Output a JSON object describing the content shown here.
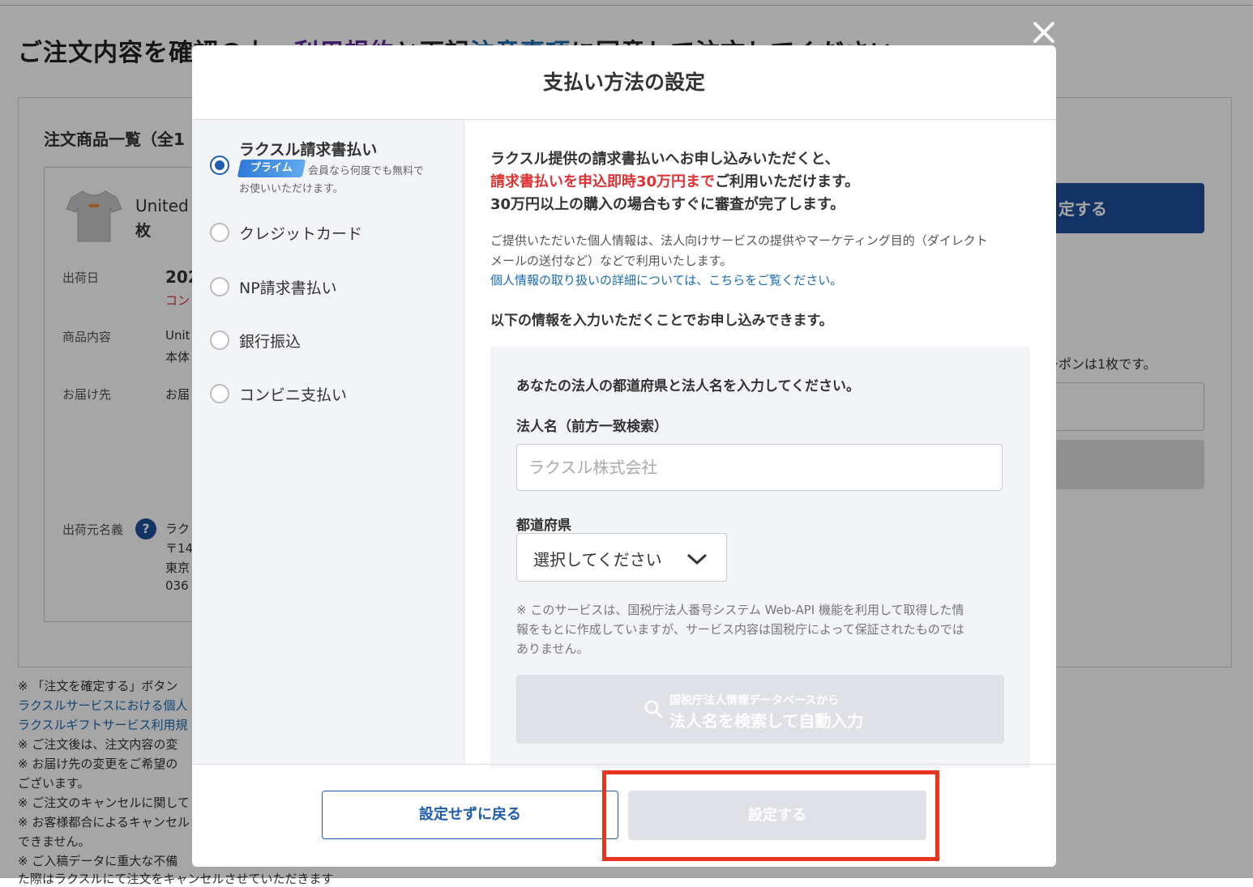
{
  "background": {
    "heading_prefix": "ご注文内容を確認の上、",
    "heading_link1": "利用規約",
    "heading_mid": "と下記",
    "heading_link2": "注意事項",
    "heading_suffix": "に同意して注文してください",
    "order_list_title": "注文商品一覧（全1",
    "product_name": "United",
    "product_qty": "枚",
    "ship_date_label": "出荷日",
    "ship_date_value": "202",
    "ship_date_note": "コン",
    "content_label": "商品内容",
    "content_value1": "Unit",
    "content_value2": "本体",
    "dest_label": "お届け先",
    "dest_value": "お届",
    "sender_label": "出荷元名義",
    "sender_help": "?",
    "sender_v1": "ラク",
    "sender_v2": "〒14",
    "sender_v3": "東京",
    "sender_v4": "036",
    "confirm_btn": "定する",
    "coupon_note": "ーポンは1枚です。",
    "notes": [
      "※ 「注文を確定する」ボタン",
      "ラクスルサービスにおける個人",
      "ラクスルギフトサービス利用規",
      "※ ご注文後は、注文内容の変",
      "※ お届け先の変更をご希望の",
      "ございます。",
      "※ ご注文のキャンセルに関して",
      "※ お客様都合によるキャンセル",
      "できません。",
      "※ ご入稿データに重大な不備",
      "た際はラクスルにて注文をキャンセルさせていただきます"
    ],
    "colors": {
      "link_purple": "#5b2a9a",
      "link_blue": "#1a6bb0",
      "primary": "#1f4f9c"
    }
  },
  "modal": {
    "title": "支払い方法の設定",
    "close_icon": "close-icon",
    "payment_options": [
      {
        "label": "ラクスル請求書払い",
        "selected": true
      },
      {
        "label": "クレジットカード",
        "selected": false
      },
      {
        "label": "NP請求書払い",
        "selected": false
      },
      {
        "label": "銀行振込",
        "selected": false
      },
      {
        "label": "コンビニ支払い",
        "selected": false
      }
    ],
    "prime_badge": "プライム",
    "prime_note1": "会員なら何度でも無料で",
    "prime_note2": "お使いいただけます。",
    "intro1": "ラクスル提供の請求書払いへお申し込みいただくと、",
    "intro2_red": "請求書払いを申込即時30万円まで",
    "intro2_rest": "ご利用いただけます。",
    "intro3": "30万円以上の購入の場合もすぐに審査が完了します。",
    "privacy1": "ご提供いただいた個人情報は、法人向けサービスの提供やマーケティング目的（ダイレクト",
    "privacy2": "メールの送付など）などで利用いたします。",
    "privacy_link": "個人情報の取り扱いの詳細については、こちらをご覧ください。",
    "apply_note": "以下の情報を入力いただくことでお申し込みできます。",
    "form": {
      "instruction": "あなたの法人の都道府県と法人名を入力してください。",
      "corp_label": "法人名（前方一致検索）",
      "corp_placeholder": "ラクスル株式会社",
      "pref_label": "都道府県",
      "pref_value": "選択してください",
      "note1": "※ このサービスは、国税庁法人番号システム Web-API 機能を利用して取得した情",
      "note2": "報をもとに作成していますが、サービス内容は国税庁によって保証されたものでは",
      "note3": "ありません。",
      "search_line1": "国税庁法人情報データベースから",
      "search_line2": "法人名を検索して自動入力"
    },
    "back_button": "設定せずに戻る",
    "set_button": "設定する",
    "colors": {
      "primary": "#1f5db0",
      "red": "#d33333",
      "highlight": "#e8361e",
      "disabled": "#dfe1e6"
    }
  }
}
